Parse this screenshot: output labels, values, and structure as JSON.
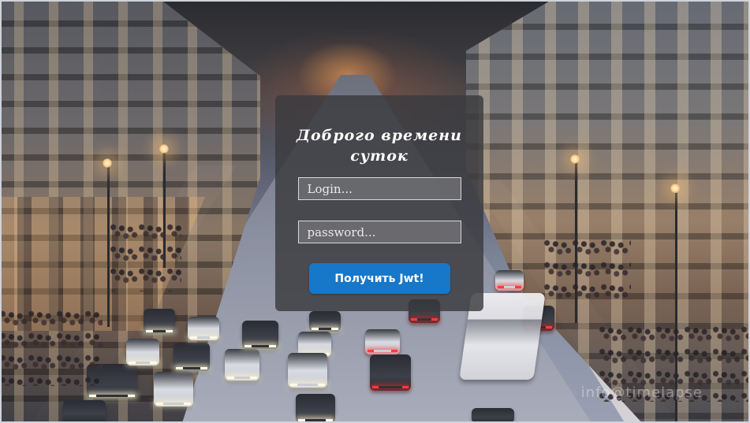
{
  "login_form": {
    "title": "Доброго времени суток",
    "login_placeholder": "Login...",
    "password_placeholder": "password...",
    "submit_label": "Получить Jwt!"
  },
  "background": {
    "watermark": "info@timelapse"
  },
  "colors": {
    "button": "#1777c9",
    "card": "#3a3a3e",
    "text": "#ffffff"
  }
}
